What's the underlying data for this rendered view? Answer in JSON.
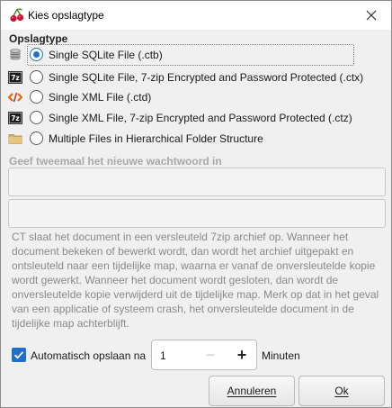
{
  "window": {
    "title": "Kies opslagtype",
    "close_icon": "close-icon",
    "app_icon": "cherry-icon"
  },
  "storage": {
    "section_label": "Opslagtype",
    "options": [
      {
        "label": "Single SQLite File (.ctb)",
        "icon": "database-icon",
        "selected": true
      },
      {
        "label": "Single SQLite File, 7-zip Encrypted and Password Protected (.ctx)",
        "icon": "7zip-icon",
        "selected": false
      },
      {
        "label": "Single XML File (.ctd)",
        "icon": "xml-code-icon",
        "selected": false
      },
      {
        "label": "Single XML File, 7-zip Encrypted and Password Protected (.ctz)",
        "icon": "7zip-icon",
        "selected": false
      },
      {
        "label": "Multiple Files in Hierarchical Folder Structure",
        "icon": "folder-icon",
        "selected": false
      }
    ]
  },
  "password": {
    "label": "Geef tweemaal het nieuwe wachtwoord in",
    "field1_value": "",
    "field2_value": ""
  },
  "description": "CT slaat het document in een versleuteld 7zip archief op. Wanneer het document bekeken of bewerkt wordt, dan wordt het archief uitgepakt en ontsleuteld naar een tijdelijke map, waarna er vanaf de onversleutelde kopie wordt gewerkt. Wanneer het document wordt gesloten, dan wordt de onversleutelde kopie verwijderd uit de tijdelijke map. Merk op dat in het geval van een applicatie of systeem crash, het onversleutelde document in de tijdelijke map achterblijft.",
  "autosave": {
    "checked": true,
    "label": "Automatisch opslaan na",
    "value": "1",
    "minus": "−",
    "plus": "+",
    "unit": "Minuten"
  },
  "buttons": {
    "cancel": "Annuleren",
    "ok": "Ok"
  },
  "colors": {
    "accent": "#1e6fd0"
  }
}
